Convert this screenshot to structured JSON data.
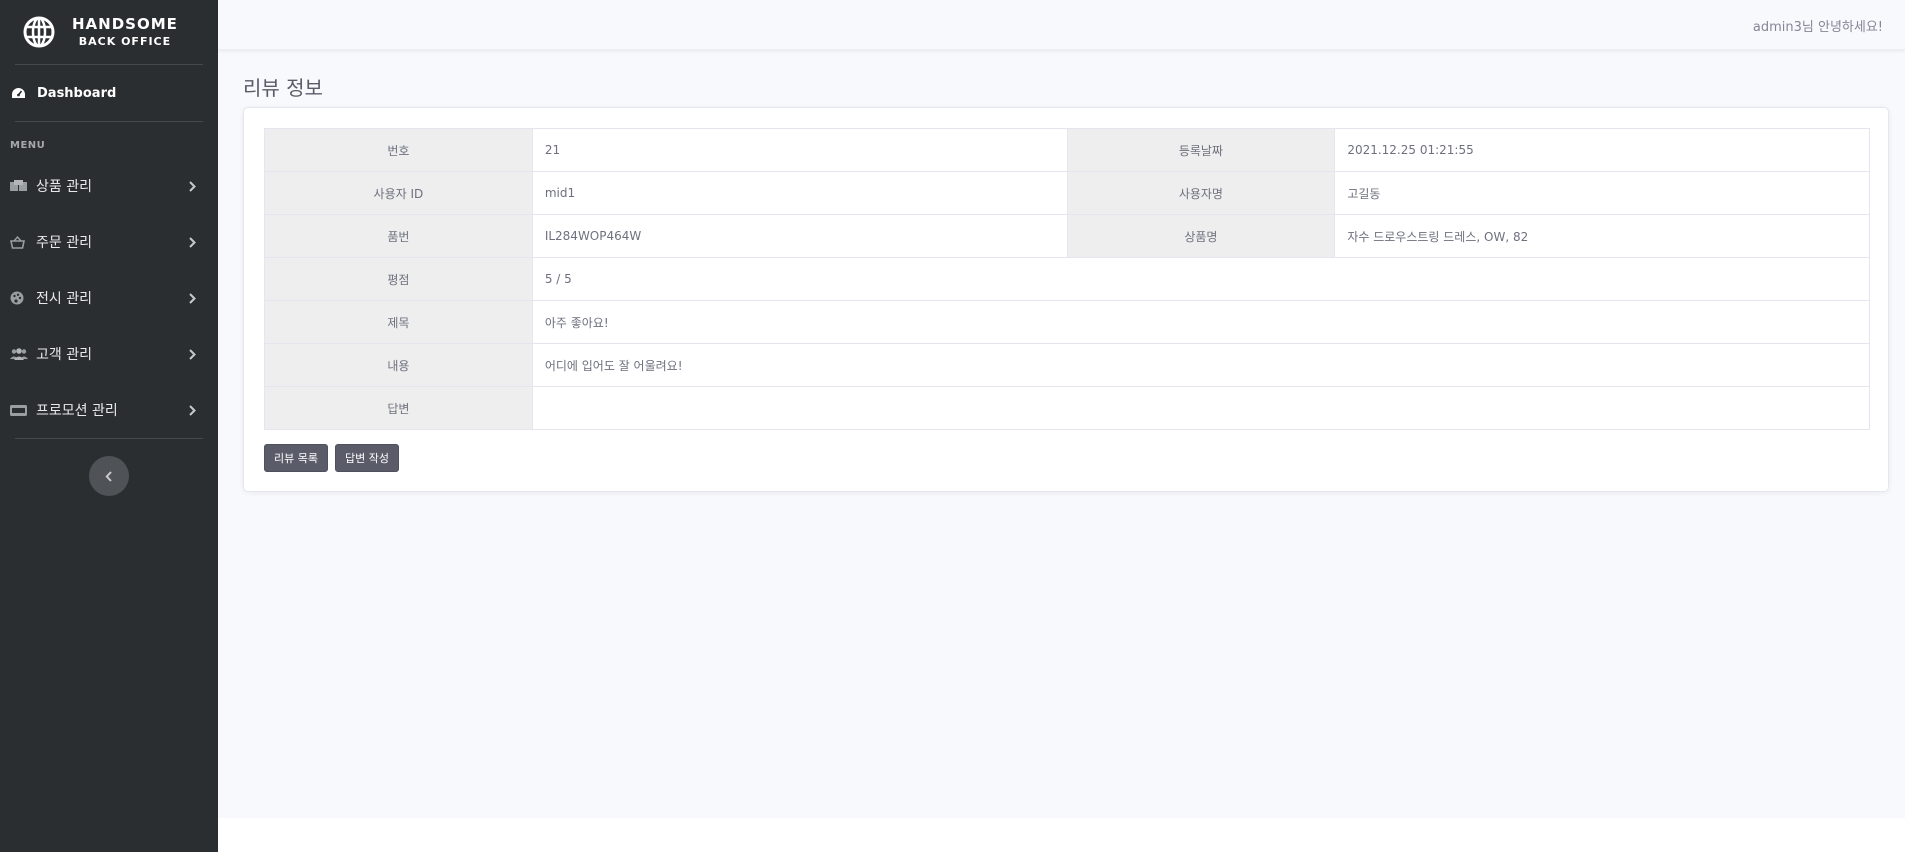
{
  "brand": {
    "line1": "HANDSOME",
    "line2": "BACK OFFICE"
  },
  "sidebar": {
    "dashboard": "Dashboard",
    "menu_heading": "MENU",
    "items": [
      {
        "label": "상품 관리",
        "icon": "boxes-icon"
      },
      {
        "label": "주문 관리",
        "icon": "basket-icon"
      },
      {
        "label": "전시 관리",
        "icon": "palette-icon"
      },
      {
        "label": "고객 관리",
        "icon": "users-icon"
      },
      {
        "label": "프로모션 관리",
        "icon": "ticket-icon"
      }
    ]
  },
  "topbar": {
    "greeting": "admin3님 안녕하세요!"
  },
  "page": {
    "title": "리뷰 정보"
  },
  "review": {
    "no_label": "번호",
    "no": "21",
    "date_label": "등록날짜",
    "date": "2021.12.25 01:21:55",
    "user_id_label": "사용자 ID",
    "user_id": "mid1",
    "user_name_label": "사용자명",
    "user_name": "고길동",
    "product_code_label": "품번",
    "product_code": "IL284WOP464W",
    "product_name_label": "상품명",
    "product_name": "자수 드로우스트링 드레스, OW, 82",
    "rating_label": "평점",
    "rating": "5 / 5",
    "subject_label": "제목",
    "subject": "아주 좋아요!",
    "content_label": "내용",
    "content": "어디에 입어도 잘 어울려요!",
    "answer_label": "답변",
    "answer": ""
  },
  "buttons": {
    "list": "리뷰 목록",
    "write_answer": "답변 작성"
  }
}
